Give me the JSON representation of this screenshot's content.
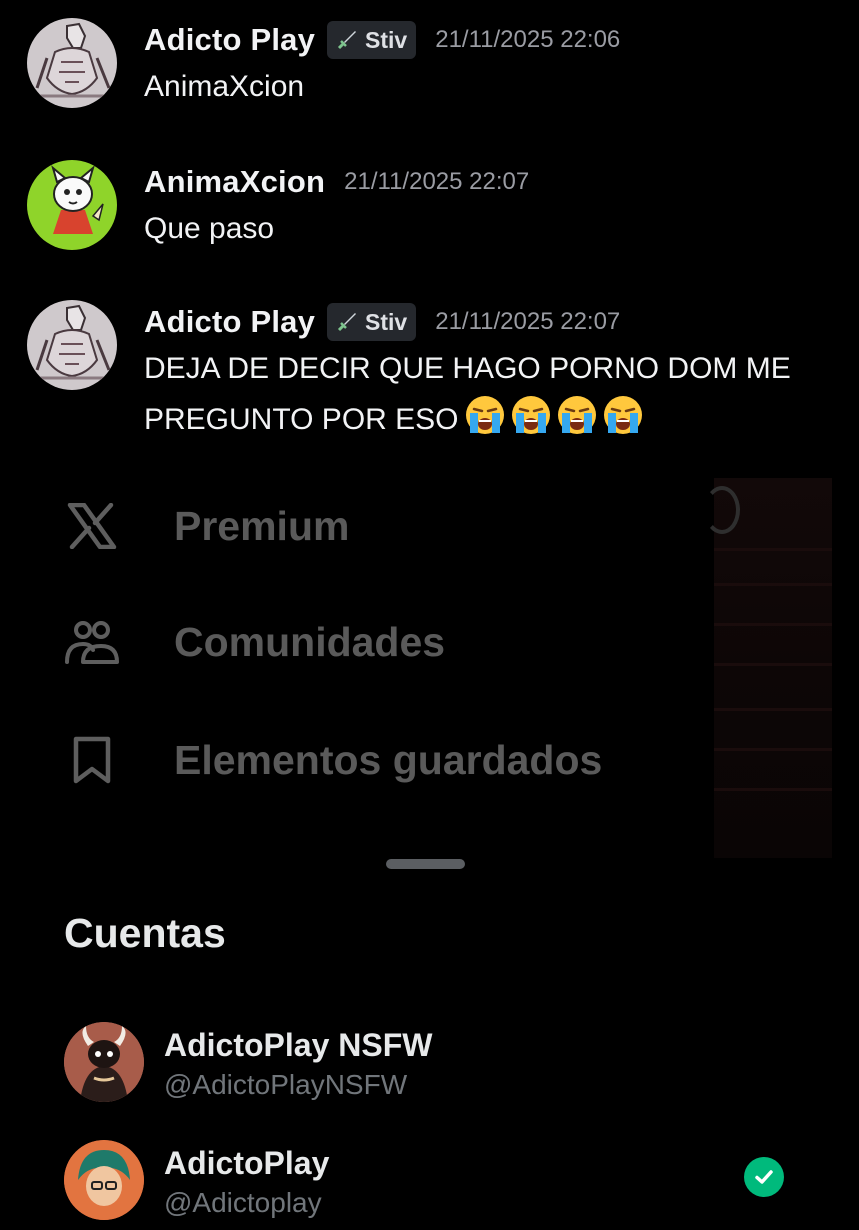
{
  "messages": [
    {
      "author": "Adicto Play",
      "tag": "Stiv",
      "tag_icon": "sword-icon",
      "time": "21/11/2025 22:06",
      "text": "AnimaXcion",
      "avatar": "sketch-warrior-avatar"
    },
    {
      "author": "AnimaXcion",
      "time": "21/11/2025 22:07",
      "text": "Que paso",
      "avatar": "green-cat-character-avatar"
    },
    {
      "author": "Adicto Play",
      "tag": "Stiv",
      "tag_icon": "sword-icon",
      "time": "21/11/2025 22:07",
      "text": "DEJA DE DECIR QUE HAGO PORNO DOM ME PREGUNTO POR ESO",
      "emojis": [
        "loudly-crying-face",
        "loudly-crying-face",
        "loudly-crying-face",
        "loudly-crying-face"
      ],
      "avatar": "sketch-warrior-avatar"
    }
  ],
  "drawer": {
    "items": [
      {
        "label": "Premium",
        "icon": "x-logo-icon"
      },
      {
        "label": "Comunidades",
        "icon": "people-icon"
      },
      {
        "label": "Elementos guardados",
        "icon": "bookmark-icon"
      }
    ]
  },
  "accounts": {
    "title": "Cuentas",
    "items": [
      {
        "name": "AdictoPlay NSFW",
        "handle": "@AdictoPlayNSFW",
        "avatar": "horned-character-avatar",
        "active": false
      },
      {
        "name": "AdictoPlay",
        "handle": "@Adictoplay",
        "avatar": "teal-hair-character-avatar",
        "active": true
      }
    ]
  },
  "colors": {
    "background": "#000000",
    "tag_background": "#25282d",
    "timestamp": "#9a9ca3",
    "dimmed_text": "#5a5a5a",
    "handle": "#71767b",
    "check": "#00ba7c"
  }
}
